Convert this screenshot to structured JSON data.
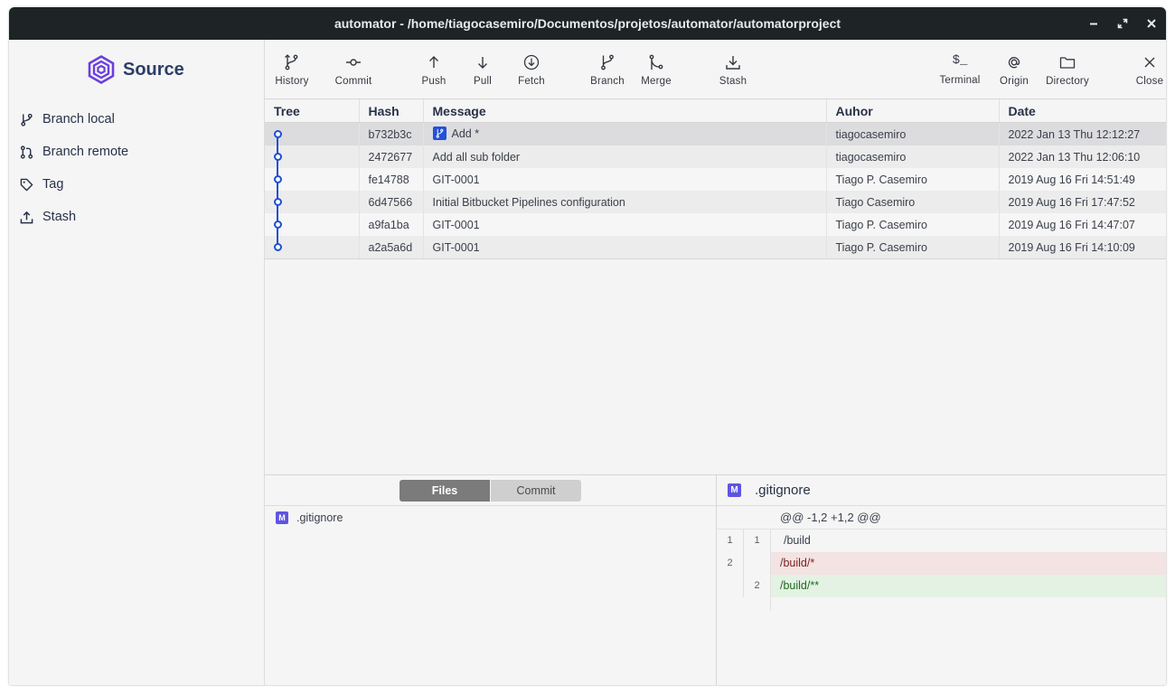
{
  "window": {
    "title": "automator - /home/tiagocasemiro/Documentos/projetos/automator/automatorproject",
    "controls": [
      "minimize-icon",
      "maximize-icon",
      "close-icon"
    ]
  },
  "sidebar": {
    "app_name": "Source",
    "logo_color": "#6a3fe0",
    "items": [
      {
        "label": "Branch local",
        "icon": "branch-icon"
      },
      {
        "label": "Branch remote",
        "icon": "pull-request-icon"
      },
      {
        "label": "Tag",
        "icon": "tag-icon"
      },
      {
        "label": "Stash",
        "icon": "upload-icon"
      }
    ]
  },
  "toolbar": {
    "history": "History",
    "commit": "Commit",
    "push": "Push",
    "pull": "Pull",
    "fetch": "Fetch",
    "branch": "Branch",
    "merge": "Merge",
    "stash": "Stash",
    "terminal": "Terminal",
    "terminal_glyph": "$_",
    "origin": "Origin",
    "directory": "Directory",
    "close": "Close"
  },
  "commits": {
    "columns": {
      "tree": "Tree",
      "hash": "Hash",
      "message": "Message",
      "author": "Auhor",
      "date": "Date"
    },
    "rows": [
      {
        "hash": "b732b3c",
        "message": "Add *",
        "author": "tiagocasemiro",
        "date": "2022 Jan 13 Thu 12:12:27"
      },
      {
        "hash": "2472677",
        "message": "Add all sub folder",
        "author": "tiagocasemiro",
        "date": "2022 Jan 13 Thu 12:06:10"
      },
      {
        "hash": "fe14788",
        "message": "GIT-0001",
        "author": "Tiago P. Casemiro",
        "date": "2019 Aug 16 Fri 14:51:49"
      },
      {
        "hash": "6d47566",
        "message": "Initial Bitbucket Pipelines configuration",
        "author": "Tiago Casemiro",
        "date": "2019 Aug 16 Fri 17:47:52"
      },
      {
        "hash": "a9fa1ba",
        "message": "GIT-0001",
        "author": "Tiago P. Casemiro",
        "date": "2019 Aug 16 Fri 14:47:07"
      },
      {
        "hash": "a2a5a6d",
        "message": "GIT-0001",
        "author": "Tiago P. Casemiro",
        "date": "2019 Aug 16 Fri 14:10:09"
      }
    ],
    "tree_color": "#1e4fd6",
    "branch_tag_color": "#2451d8"
  },
  "files_panel": {
    "tabs": [
      "Files",
      "Commit"
    ],
    "active_tab": "Files",
    "files": [
      {
        "status": "M",
        "name": ".gitignore"
      }
    ],
    "status_color": "#5f55e0"
  },
  "diff_panel": {
    "status": "M",
    "filename": ".gitignore",
    "hunk": "@@ -1,2 +1,2 @@",
    "lines": [
      {
        "type": "ctx",
        "old": "1",
        "new": "1",
        "text": "/build"
      },
      {
        "type": "del",
        "old": "2",
        "new": "",
        "text": "/build/*"
      },
      {
        "type": "add",
        "old": "",
        "new": "2",
        "text": "/build/**"
      }
    ]
  }
}
